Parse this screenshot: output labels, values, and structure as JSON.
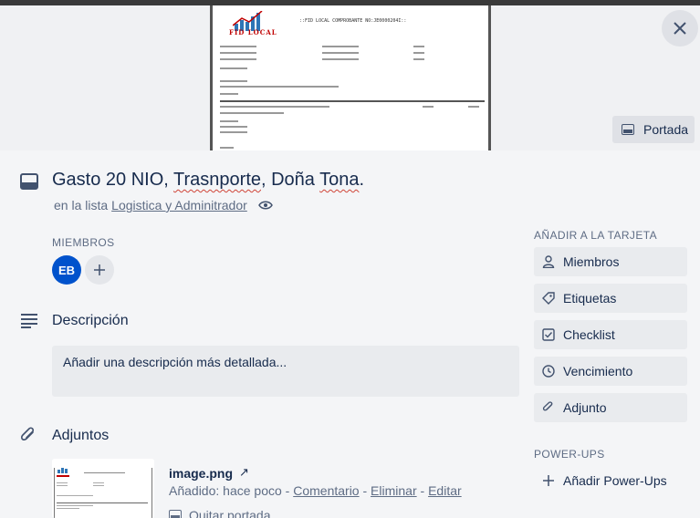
{
  "cover": {
    "doc_heading": "::FID LOCAL COMPROBANTE NO:JE0000204I::",
    "logo_text": "FID LOCAL",
    "portada_label": "Portada"
  },
  "card": {
    "title_parts": [
      "Gasto 20 NIO, ",
      "Trasnporte",
      ", Doña ",
      "Tona",
      "."
    ],
    "list_prefix": "en la lista",
    "list_name": "Logistica y Adminitrador"
  },
  "members": {
    "label": "MIEMBROS",
    "avatar_initials": "EB"
  },
  "description": {
    "title": "Descripción",
    "placeholder": "Añadir una descripción más detallada..."
  },
  "attachments": {
    "title": "Adjuntos",
    "file_name": "image.png",
    "open_arrow": "↗",
    "added": "Añadido: hace poco",
    "sep": " - ",
    "comment": "Comentario",
    "delete": "Eliminar",
    "edit": "Editar",
    "remove_cover": "Quitar portada"
  },
  "sidebar": {
    "add_label": "AÑADIR A LA TARJETA",
    "buttons": [
      {
        "label": "Miembros",
        "icon": "person-icon"
      },
      {
        "label": "Etiquetas",
        "icon": "label-icon"
      },
      {
        "label": "Checklist",
        "icon": "checklist-icon"
      },
      {
        "label": "Vencimiento",
        "icon": "clock-icon"
      },
      {
        "label": "Adjunto",
        "icon": "paperclip-icon"
      }
    ],
    "powerups_label": "POWER-UPS",
    "add_powerups": "Añadir Power-Ups"
  }
}
